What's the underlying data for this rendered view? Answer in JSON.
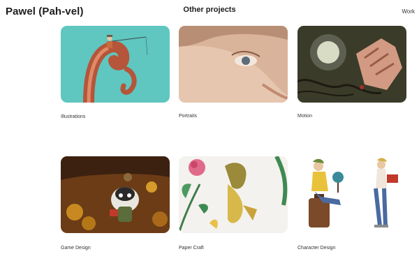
{
  "header": {
    "site_title": "Pawel (Pah-vel)",
    "section_title": "Other projects",
    "nav_work": "Work"
  },
  "projects": [
    {
      "label": "Illustrations",
      "thumb_bg": "#5fc6c0"
    },
    {
      "label": "Portraits",
      "thumb_bg": "#d9b49a"
    },
    {
      "label": "Motion",
      "thumb_bg": "#3a3b28"
    },
    {
      "label": "Game Design",
      "thumb_bg": "#6b3c16"
    },
    {
      "label": "Paper Craft",
      "thumb_bg": "#f4f2ee"
    },
    {
      "label": "Character Design",
      "thumb_bg": "#ffffff"
    }
  ]
}
